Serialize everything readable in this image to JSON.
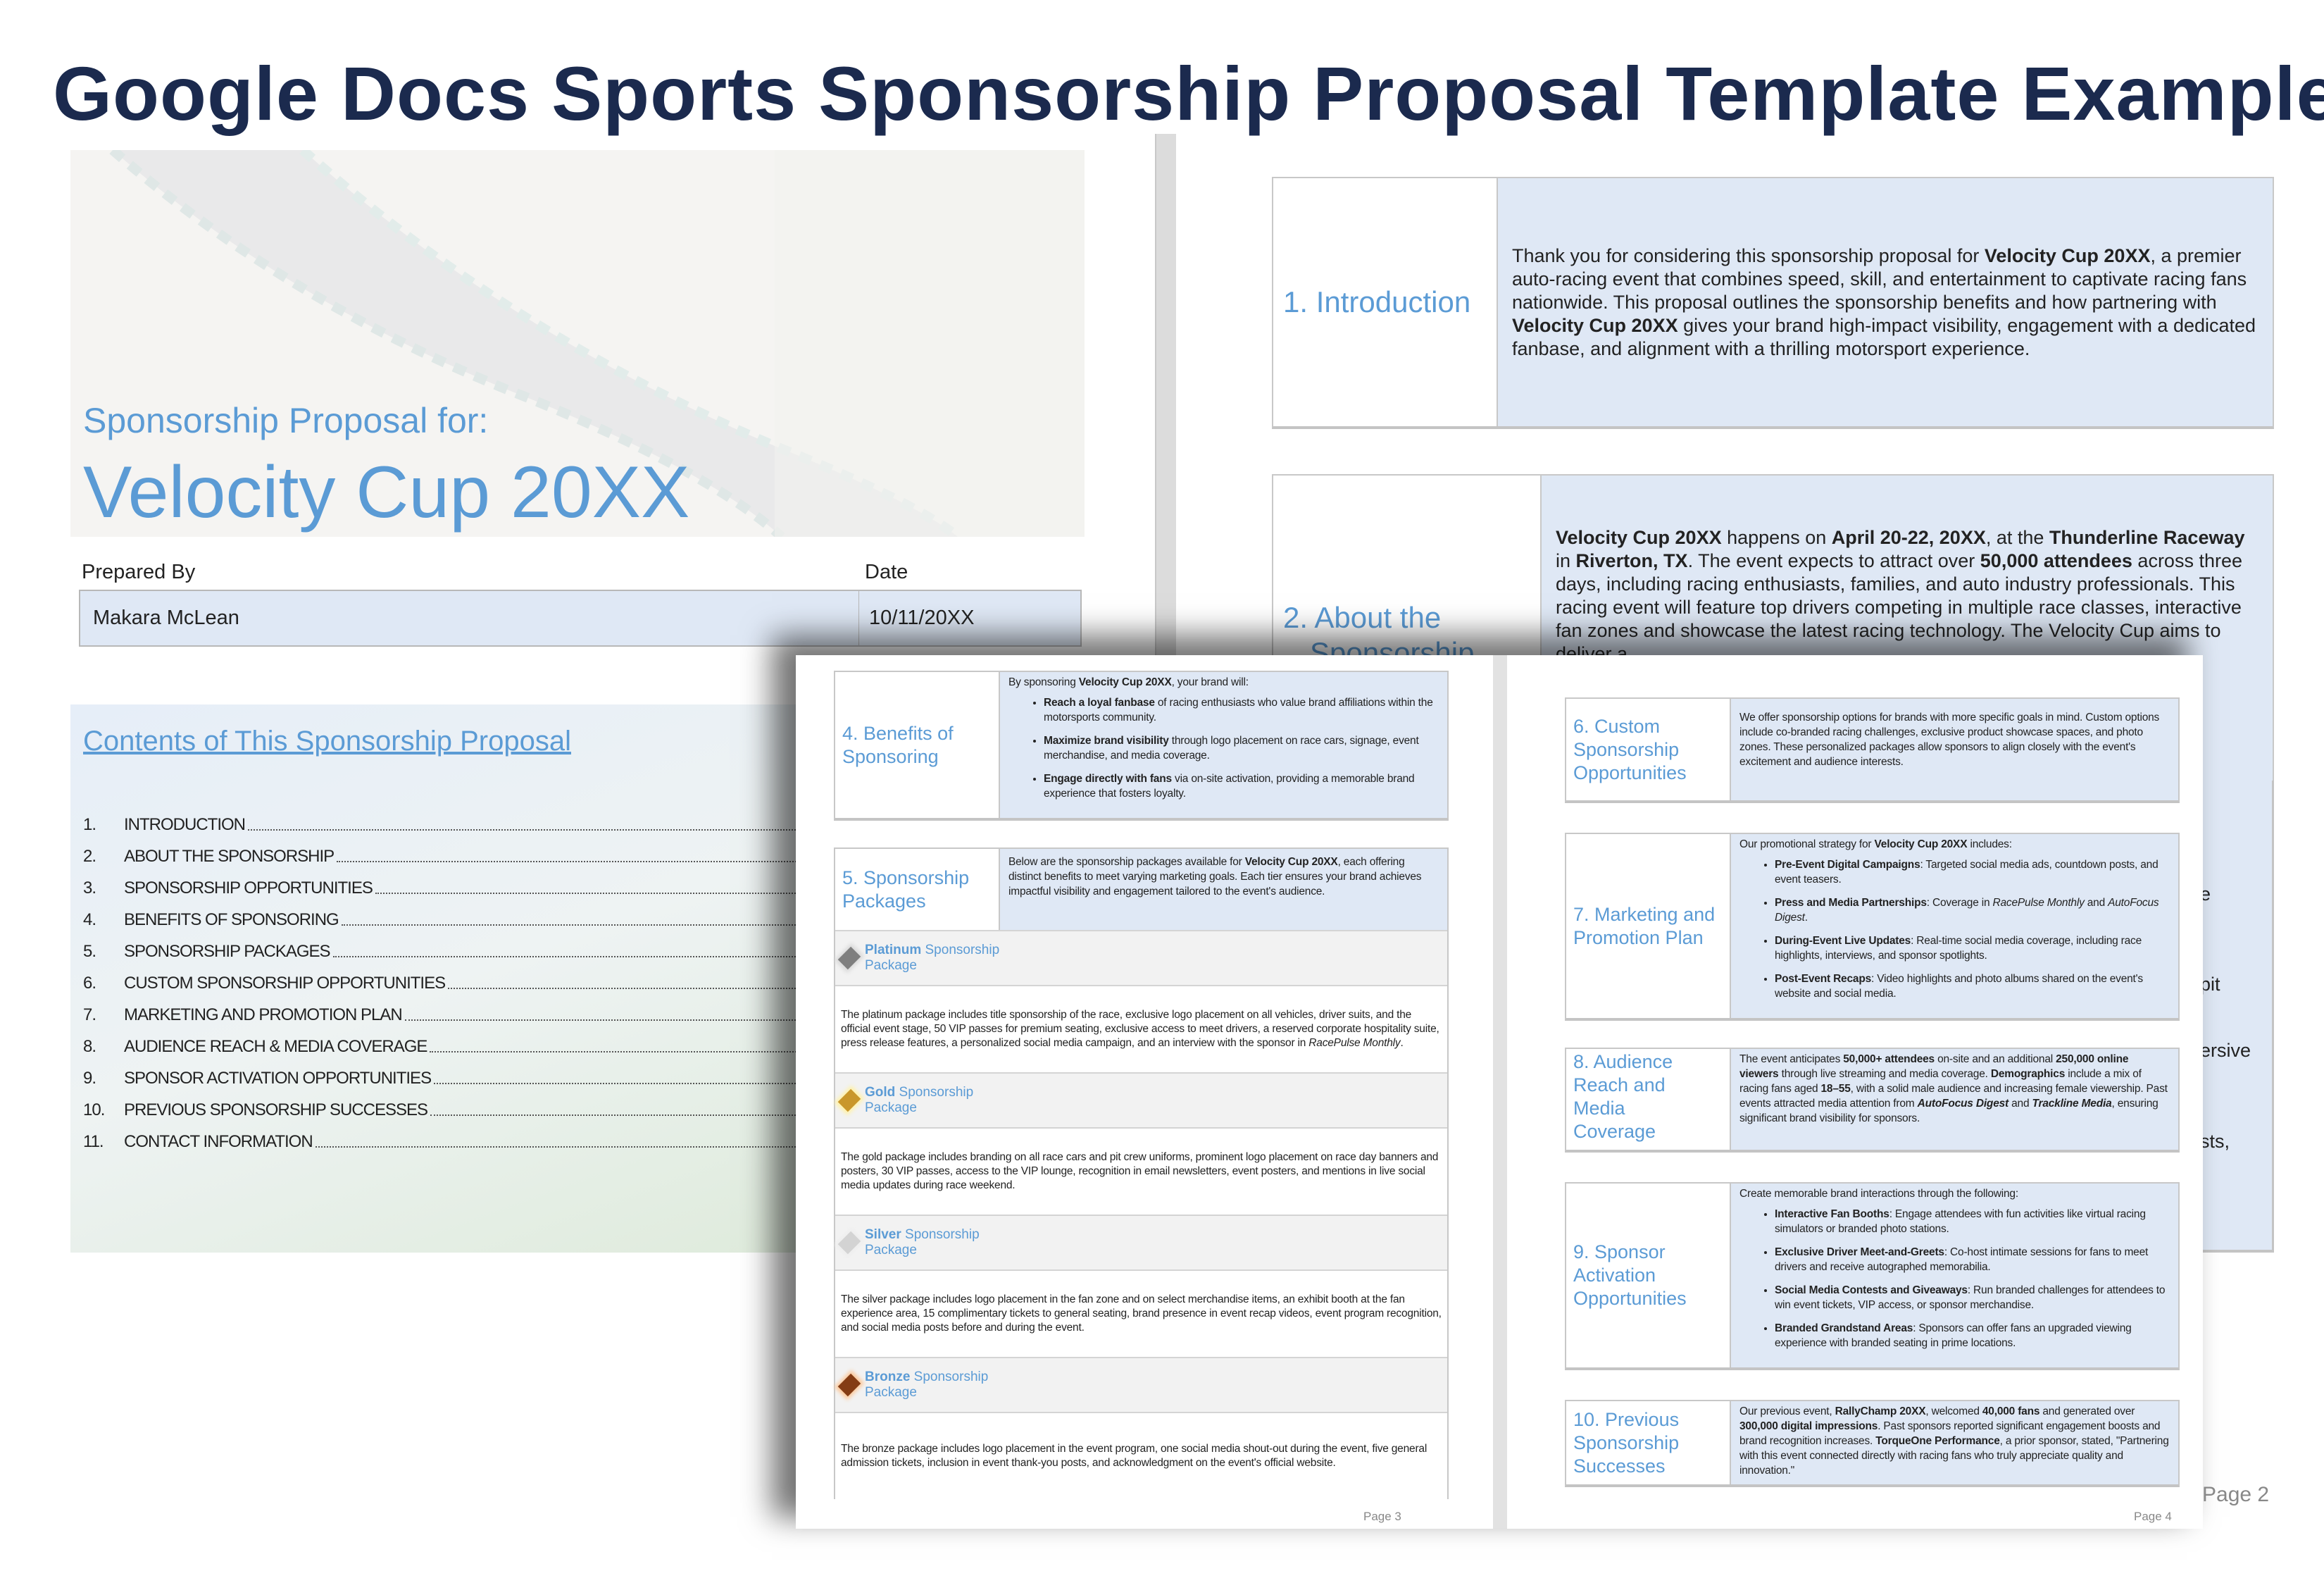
{
  "title": "Google Docs Sports Sponsorship Proposal Template Example",
  "colors": {
    "accent_blue": "#5b9bd5",
    "title_navy": "#1b2a4e",
    "cell_fill": "#dfe8f5"
  },
  "cover": {
    "subtitle": "Sponsorship Proposal for:",
    "event_name": "Velocity Cup 20XX",
    "prepared_by_label": "Prepared By",
    "date_label": "Date",
    "prepared_by": "Makara McLean",
    "date": "10/11/20XX",
    "contents_title": "Contents of This Sponsorship Proposal",
    "toc": [
      {
        "num": "1.",
        "label": "INTRODUCTION"
      },
      {
        "num": "2.",
        "label": "ABOUT THE SPONSORSHIP"
      },
      {
        "num": "3.",
        "label": "SPONSORSHIP OPPORTUNITIES"
      },
      {
        "num": "4.",
        "label": "BENEFITS OF SPONSORING"
      },
      {
        "num": "5.",
        "label": "SPONSORSHIP PACKAGES"
      },
      {
        "num": "6.",
        "label": "CUSTOM SPONSORSHIP OPPORTUNITIES"
      },
      {
        "num": "7.",
        "label": "MARKETING AND PROMOTION PLAN"
      },
      {
        "num": "8.",
        "label": "AUDIENCE REACH & MEDIA COVERAGE"
      },
      {
        "num": "9.",
        "label": "SPONSOR ACTIVATION OPPORTUNITIES"
      },
      {
        "num": "10.",
        "label": "PREVIOUS SPONSORSHIP SUCCESSES"
      },
      {
        "num": "11.",
        "label": "CONTACT INFORMATION"
      }
    ]
  },
  "page2": {
    "page_label": "Page 2",
    "sections": [
      {
        "label": [
          "1. Introduction"
        ],
        "body": {
          "intro": [
            [
              "Thank you for considering this sponsorship proposal for ",
              ""
            ],
            [
              "Velocity Cup 20XX",
              "b"
            ],
            [
              ", a premier auto-racing event that combines speed, skill, and entertainment to captivate racing fans nationwide. This proposal outlines the sponsorship benefits and how partnering with ",
              ""
            ],
            [
              "Velocity Cup 20XX",
              "b"
            ],
            [
              " gives your brand high-impact visibility, engagement with a dedicated fanbase, and alignment with a thrilling motorsport experience.",
              ""
            ]
          ]
        }
      },
      {
        "label": [
          "2. About the",
          "Sponsorship"
        ],
        "body": {
          "intro": [
            [
              "Velocity Cup 20XX",
              "b"
            ],
            [
              " happens on ",
              ""
            ],
            [
              "April 20-22, 20XX",
              "b"
            ],
            [
              ", at the ",
              ""
            ],
            [
              "Thunderline Raceway",
              "b"
            ],
            [
              " in ",
              ""
            ],
            [
              "Riverton, TX",
              "b"
            ],
            [
              ". The event expects to attract over ",
              ""
            ],
            [
              "50,000 attendees",
              "b"
            ],
            [
              " across three days, including racing enthusiasts, families, and auto industry professionals. This racing event will feature top drivers competing in multiple race classes, interactive fan zones and showcase the latest racing technology. The Velocity Cup aims to deliver a",
              ""
            ]
          ]
        }
      }
    ],
    "partial_fragments": [
      "e",
      "pit",
      "ersive",
      "sts,"
    ]
  },
  "page3": {
    "page_label": "Page 3",
    "sections": [
      {
        "label": [
          "4. Benefits of",
          "Sponsoring"
        ],
        "body": {
          "intro": [
            [
              "By sponsoring ",
              ""
            ],
            [
              "Velocity Cup 20XX",
              "b"
            ],
            [
              ", your brand will:",
              ""
            ]
          ],
          "bullets": [
            [
              [
                "Reach a loyal fanbase",
                "b"
              ],
              [
                " of racing enthusiasts who value brand affiliations within the motorsports community.",
                ""
              ]
            ],
            [
              [
                "Maximize brand visibility",
                "b"
              ],
              [
                " through logo placement on race cars, signage, event merchandise, and media coverage.",
                ""
              ]
            ],
            [
              [
                "Engage directly with fans",
                "b"
              ],
              [
                " via on-site activation, providing a memorable brand experience that fosters loyalty.",
                ""
              ]
            ]
          ]
        }
      },
      {
        "label": [
          "5. Sponsorship",
          "Packages"
        ],
        "body": {
          "intro": [
            [
              "Below are the sponsorship packages available for ",
              ""
            ],
            [
              "Velocity Cup 20XX",
              "b"
            ],
            [
              ", each offering distinct benefits to meet varying marketing goals. Each tier ensures your brand achieves impactful visibility and engagement tailored to the event's audience.",
              ""
            ]
          ]
        }
      }
    ],
    "packages": [
      {
        "tier": "Platinum",
        "rest": " Sponsorship",
        "line2": "Package",
        "icon": "platinum-diamond-icon",
        "color": "#7f7f7f",
        "glow": "#d9d9d9",
        "description": [
          [
            "The platinum package includes title sponsorship of the race, exclusive logo placement on all vehicles, driver suits, and the official event stage, 50 VIP passes for premium seating, exclusive access to meet drivers, a reserved corporate hospitality suite, press release features, a personalized social media campaign, and an interview with the sponsor in ",
            ""
          ],
          [
            "RacePulse Monthly",
            "i"
          ],
          [
            ".",
            ""
          ]
        ]
      },
      {
        "tier": "Gold",
        "rest": " Sponsorship",
        "line2": "Package",
        "icon": "gold-diamond-icon",
        "color": "#c9972b",
        "glow": "#fff2a8",
        "description": [
          [
            "The gold package includes branding on all race cars and pit crew uniforms, prominent logo placement on race day banners and posters, 30 VIP passes, access to the VIP lounge, recognition in email newsletters, event posters, and mentions in live social media updates during race weekend.",
            ""
          ]
        ]
      },
      {
        "tier": "Silver",
        "rest": " Sponsorship",
        "line2": "Package",
        "icon": "silver-diamond-icon",
        "color": "#d3d3d3",
        "glow": "#eeeeee",
        "description": [
          [
            "The silver package includes logo placement in the fan zone and on select merchandise items, an exhibit booth at the fan experience area, 15 complimentary tickets to general seating, brand presence in event recap videos, event program recognition, and social media posts before and during the event.",
            ""
          ]
        ]
      },
      {
        "tier": "Bronze",
        "rest": " Sponsorship",
        "line2": "Package",
        "icon": "bronze-diamond-icon",
        "color": "#843c14",
        "glow": "#fbc89a",
        "description": [
          [
            "The bronze package includes logo placement in the event program, one social media shout-out during the event, five general admission tickets, inclusion in event thank-you posts, and acknowledgment on the event's official website.",
            ""
          ]
        ]
      }
    ]
  },
  "page4": {
    "page_label": "Page 4",
    "sections": [
      {
        "label": [
          "6. Custom",
          "Sponsorship",
          "Opportunities"
        ],
        "body": {
          "intro": [
            [
              "We offer sponsorship options for brands with more specific goals in mind. Custom options include co-branded racing challenges, exclusive product showcase spaces, and photo zones. These personalized packages allow sponsors to align closely with the event's excitement and audience interests.",
              ""
            ]
          ]
        }
      },
      {
        "label": [
          "7. Marketing and",
          "Promotion Plan"
        ],
        "body": {
          "intro": [
            [
              "Our promotional strategy for ",
              ""
            ],
            [
              "Velocity Cup 20XX",
              "b"
            ],
            [
              " includes:",
              ""
            ]
          ],
          "bullets": [
            [
              [
                "Pre-Event Digital Campaigns",
                "b"
              ],
              [
                ": Targeted social media ads, countdown posts, and event teasers.",
                ""
              ]
            ],
            [
              [
                "Press and Media Partnerships",
                "b"
              ],
              [
                ": Coverage in ",
                ""
              ],
              [
                "RacePulse Monthly",
                "i"
              ],
              [
                " and ",
                ""
              ],
              [
                "AutoFocus Digest",
                "i"
              ],
              [
                ".",
                ""
              ]
            ],
            [
              [
                "During-Event Live Updates",
                "b"
              ],
              [
                ": Real-time social media coverage, including race highlights, interviews, and sponsor spotlights.",
                ""
              ]
            ],
            [
              [
                "Post-Event Recaps",
                "b"
              ],
              [
                ": Video highlights and photo albums shared on the event's website and social media.",
                ""
              ]
            ]
          ]
        }
      },
      {
        "label": [
          "8. Audience",
          "Reach and",
          "Media",
          "Coverage"
        ],
        "body": {
          "intro": [
            [
              "The event anticipates ",
              ""
            ],
            [
              "50,000+ attendees",
              "b"
            ],
            [
              " on-site and an additional ",
              ""
            ],
            [
              "250,000 online viewers",
              "b"
            ],
            [
              " through live streaming and media coverage. ",
              ""
            ],
            [
              "Demographics",
              "b"
            ],
            [
              " include a mix of racing fans aged ",
              ""
            ],
            [
              "18–55",
              "b"
            ],
            [
              ", with a solid male audience and increasing female viewership. Past events attracted media attention from ",
              ""
            ],
            [
              "AutoFocus Digest",
              "bi"
            ],
            [
              " and ",
              ""
            ],
            [
              "Trackline Media",
              "bi"
            ],
            [
              ", ensuring significant brand visibility for sponsors.",
              ""
            ]
          ]
        }
      },
      {
        "label": [
          "9. Sponsor",
          "Activation",
          "Opportunities"
        ],
        "body": {
          "intro": [
            [
              "Create memorable brand interactions through the following:",
              ""
            ]
          ],
          "bullets": [
            [
              [
                "Interactive Fan Booths",
                "b"
              ],
              [
                ": Engage attendees with fun activities like virtual racing simulators or branded photo stations.",
                ""
              ]
            ],
            [
              [
                "Exclusive Driver Meet-and-Greets",
                "b"
              ],
              [
                ": Co-host intimate sessions for fans to meet drivers and receive autographed memorabilia.",
                ""
              ]
            ],
            [
              [
                "Social Media Contests and Giveaways",
                "b"
              ],
              [
                ": Run branded challenges for attendees to win event tickets, VIP access, or sponsor merchandise.",
                ""
              ]
            ],
            [
              [
                "Branded Grandstand Areas",
                "b"
              ],
              [
                ": Sponsors can offer fans an upgraded viewing experience with branded seating in prime locations.",
                ""
              ]
            ]
          ]
        }
      },
      {
        "label": [
          "10.  Previous",
          "Sponsorship",
          "Successes"
        ],
        "body": {
          "intro": [
            [
              "Our previous event, ",
              ""
            ],
            [
              "RallyChamp 20XX",
              "b"
            ],
            [
              ", welcomed ",
              ""
            ],
            [
              "40,000 fans",
              "b"
            ],
            [
              " and generated over ",
              ""
            ],
            [
              "300,000 digital impressions",
              "b"
            ],
            [
              ". Past sponsors reported significant engagement boosts and brand recognition increases. ",
              ""
            ],
            [
              "TorqueOne Performance",
              "b"
            ],
            [
              ", a prior sponsor, stated, \"Partnering with this event connected directly with racing fans who truly appreciate quality and innovation.\"",
              ""
            ]
          ]
        }
      }
    ]
  }
}
